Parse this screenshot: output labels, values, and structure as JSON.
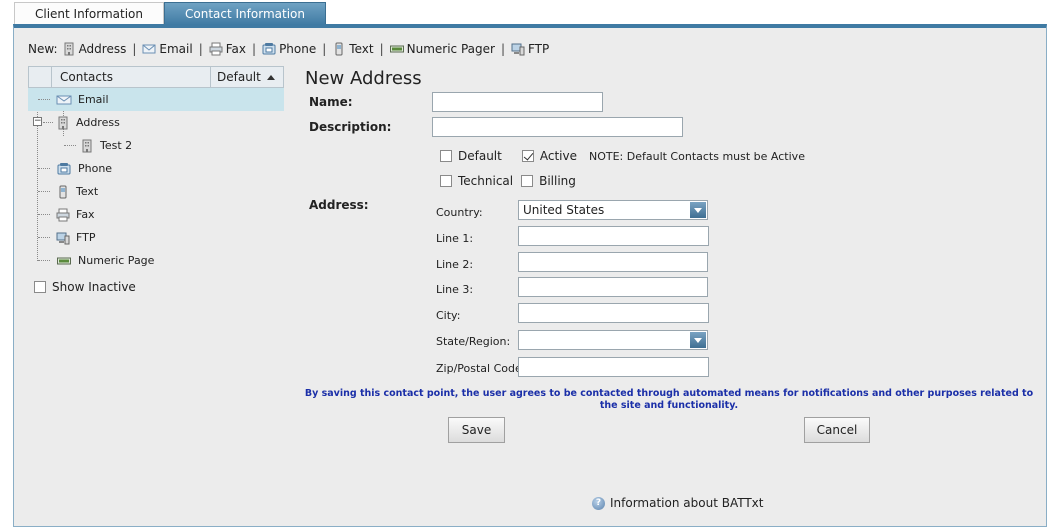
{
  "tabs": [
    {
      "label": "Client Information",
      "active": false
    },
    {
      "label": "Contact Information",
      "active": true
    }
  ],
  "newbar": {
    "prefix": "New:",
    "items": [
      "Address",
      "Email",
      "Fax",
      "Phone",
      "Text",
      "Numeric Pager",
      "FTP"
    ],
    "separator": "|"
  },
  "grid": {
    "col_contacts": "Contacts",
    "col_default": "Default"
  },
  "tree": {
    "email": "Email",
    "address": "Address",
    "test2": "Test 2",
    "phone": "Phone",
    "text": "Text",
    "fax": "Fax",
    "ftp": "FTP",
    "numeric": "Numeric Page"
  },
  "show_inactive": "Show Inactive",
  "form": {
    "title": "New Address",
    "name_label": "Name:",
    "name_value": "",
    "description_label": "Description:",
    "description_value": "",
    "default_label": "Default",
    "active_label": "Active",
    "note": "NOTE: Default Contacts must be Active",
    "technical_label": "Technical",
    "billing_label": "Billing",
    "address_label": "Address:",
    "country_label": "Country:",
    "country_value": "United States",
    "line1_label": "Line 1:",
    "line2_label": "Line 2:",
    "line3_label": "Line 3:",
    "city_label": "City:",
    "state_label": "State/Region:",
    "state_value": "",
    "zip_label": "Zip/Postal Code:",
    "consent": "By saving this contact point, the user agrees to be contacted through automated means for notifications and other purposes related to the site and functionality.",
    "save_label": "Save",
    "cancel_label": "Cancel"
  },
  "info_link": "Information about BATTxt",
  "colors": {
    "accent": "#3f7aa3",
    "selected_row": "#c9e4ec",
    "consent_text": "#1b2fa8",
    "panel_bg": "#ececec"
  }
}
